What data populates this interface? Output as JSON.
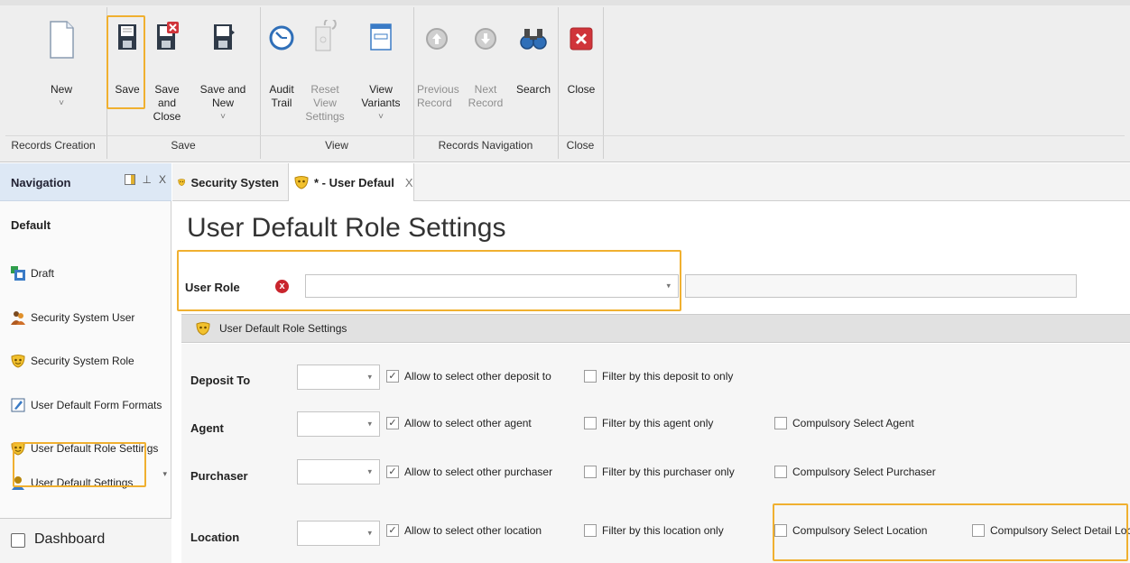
{
  "ribbon": {
    "buttons": {
      "new": "New",
      "save": "Save",
      "save_close": "Save and\nClose",
      "save_new": "Save and New",
      "audit": "Audit\nTrail",
      "reset_view": "Reset View\nSettings",
      "view_variants": "View Variants",
      "previous": "Previous\nRecord",
      "next": "Next Record",
      "search": "Search",
      "close": "Close"
    },
    "groups": {
      "records_creation": "Records Creation",
      "save": "Save",
      "view": "View",
      "records_navigation": "Records Navigation",
      "close": "Close"
    },
    "caret": "˅"
  },
  "nav": {
    "title": "Navigation",
    "group": "Default",
    "items": [
      {
        "label": "Draft",
        "icon": "draft-icon"
      },
      {
        "label": "Security System User",
        "icon": "users-icon"
      },
      {
        "label": "Security System Role",
        "icon": "mask-icon"
      },
      {
        "label": "User Default Form Formats",
        "icon": "form-format-icon"
      },
      {
        "label": "User Default Role Settings",
        "icon": "mask-icon"
      },
      {
        "label": "User Default Settings",
        "icon": "user-icon"
      }
    ],
    "dashboard": "Dashboard",
    "pin_glyph": "⊥",
    "close_glyph": "X"
  },
  "tabs": [
    {
      "label": "Security Systen"
    },
    {
      "label": "* - User Defaul",
      "close": "X"
    }
  ],
  "main": {
    "title": "User Default Role Settings",
    "user_role_label": "User Role",
    "error_glyph": "x",
    "section_title": "User Default Role Settings",
    "rows": [
      {
        "label": "Deposit To",
        "allow": "Allow to select other deposit to",
        "filter": "Filter by this deposit to only",
        "compulsory": ""
      },
      {
        "label": "Agent",
        "allow": "Allow to select other agent",
        "filter": "Filter by this agent only",
        "compulsory": "Compulsory Select Agent"
      },
      {
        "label": "Purchaser",
        "allow": "Allow to select other purchaser",
        "filter": "Filter by this purchaser only",
        "compulsory": "Compulsory Select Purchaser"
      },
      {
        "label": "Location",
        "allow": "Allow to select other location",
        "filter": "Filter by this location only",
        "compulsory": "Compulsory Select Location",
        "compulsory_detail": "Compulsory Select Detail Location"
      }
    ],
    "check_mark": "✓",
    "dropdown_arrow": "▾"
  },
  "colors": {
    "highlight": "#f0b030",
    "nav_header": "#dde8f5",
    "error": "#c9252d"
  }
}
